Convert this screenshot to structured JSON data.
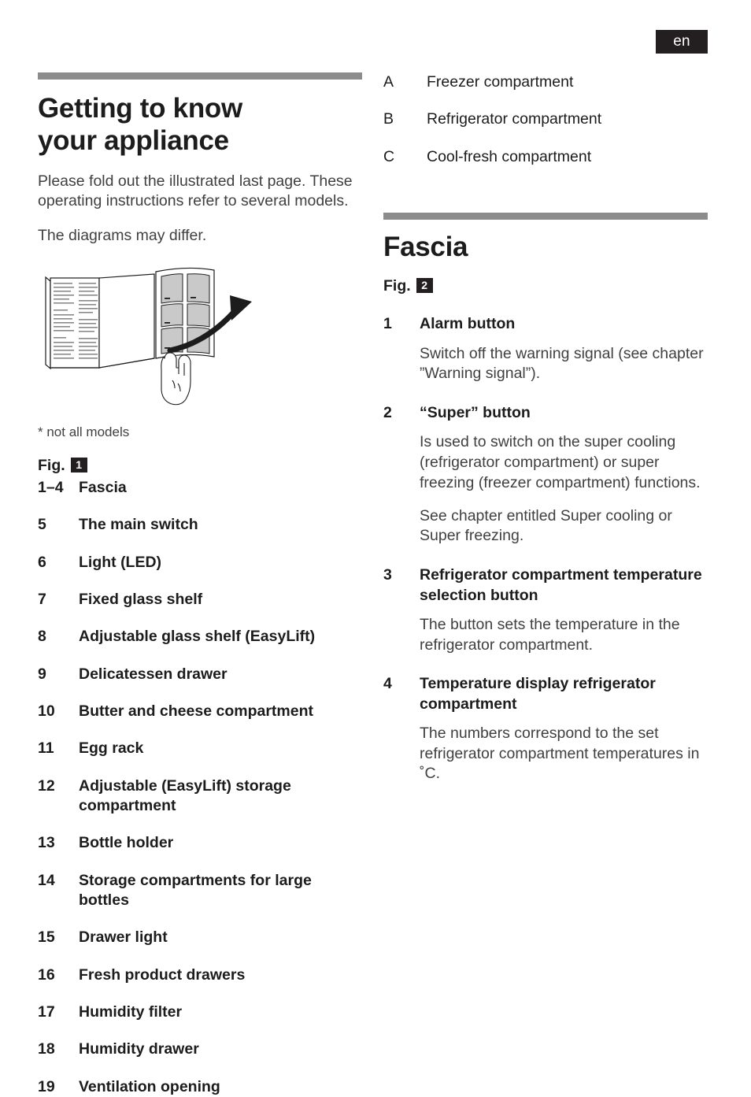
{
  "language_badge": "en",
  "left_column": {
    "heading": "Getting to know\nyour appliance",
    "heading_line1": "Getting to know",
    "heading_line2": "your appliance",
    "intro_paragraph": "Please fold out the illustrated last page. These operating instructions refer to several models.",
    "diagram_note": "The diagrams may differ.",
    "illustration": {
      "name": "fold-out-page-illustration",
      "description": "Open manual with hand folding out the illustrated last page",
      "arrow": "curved-arrow-right",
      "panel_rows": 3,
      "panel_columns": 2
    },
    "footnote": "* not all models",
    "fig_label": "Fig.",
    "fig_number": "1",
    "items": [
      {
        "num": "1–4",
        "label": "Fascia"
      },
      {
        "num": "5",
        "label": "The main switch"
      },
      {
        "num": "6",
        "label": "Light (LED)"
      },
      {
        "num": "7",
        "label": "Fixed glass shelf"
      },
      {
        "num": "8",
        "label": "Adjustable glass shelf (EasyLift)"
      },
      {
        "num": "9",
        "label": "Delicatessen drawer"
      },
      {
        "num": "10",
        "label": "Butter and cheese compartment"
      },
      {
        "num": "11",
        "label": "Egg rack"
      },
      {
        "num": "12",
        "label": "Adjustable (EasyLift) storage compartment"
      },
      {
        "num": "13",
        "label": "Bottle holder"
      },
      {
        "num": "14",
        "label": "Storage compartments for large bottles"
      },
      {
        "num": "15",
        "label": "Drawer light"
      },
      {
        "num": "16",
        "label": "Fresh product drawers"
      },
      {
        "num": "17",
        "label": "Humidity filter"
      },
      {
        "num": "18",
        "label": "Humidity drawer"
      },
      {
        "num": "19",
        "label": "Ventilation opening"
      }
    ]
  },
  "right_column": {
    "compartments": [
      {
        "num": "A",
        "label": "Freezer compartment"
      },
      {
        "num": "B",
        "label": "Refrigerator compartment"
      },
      {
        "num": "C",
        "label": "Cool-fresh compartment"
      }
    ],
    "heading": "Fascia",
    "fig_label": "Fig.",
    "fig_number": "2",
    "controls": [
      {
        "num": "1",
        "label": "Alarm button",
        "descriptions": [
          "Switch off the warning signal\n(see chapter ”Warning signal”)."
        ]
      },
      {
        "num": "2",
        "label": "“Super” button",
        "descriptions": [
          "Is used to switch on the super cooling (refrigerator compartment) or super freezing (freezer compartment) functions.",
          "See chapter entitled Super cooling or Super freezing."
        ]
      },
      {
        "num": "3",
        "label": "Refrigerator compartment temperature selection button",
        "descriptions": [
          "The button sets the temperature in the refrigerator  compartment."
        ]
      },
      {
        "num": "4",
        "label": "Temperature display refrigerator compartment",
        "descriptions": [
          "The numbers correspond to the set refrigerator compartment temperatures in ˚C."
        ]
      }
    ]
  },
  "colors": {
    "rule_gray": "#8c8c8c",
    "heading_black": "#1c1c1c",
    "body_gray": "#404040",
    "badge_black": "#231f20"
  }
}
